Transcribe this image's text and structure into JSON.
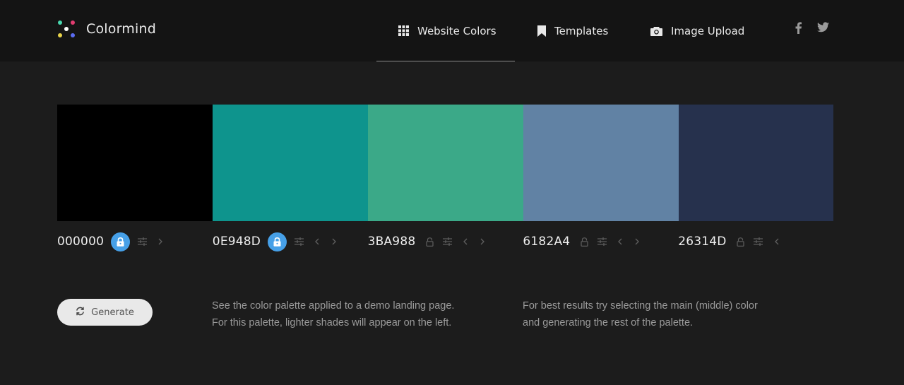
{
  "app": {
    "name": "Colormind"
  },
  "nav": [
    {
      "label": "Website Colors",
      "icon": "grid-icon",
      "active": true
    },
    {
      "label": "Templates",
      "icon": "bookmark-icon",
      "active": false
    },
    {
      "label": "Image Upload",
      "icon": "camera-icon",
      "active": false
    }
  ],
  "social": [
    {
      "icon": "facebook-icon"
    },
    {
      "icon": "twitter-icon"
    }
  ],
  "palette": [
    {
      "hex": "000000",
      "color": "#000000",
      "locked": true
    },
    {
      "hex": "0E948D",
      "color": "#0E948D",
      "locked": true
    },
    {
      "hex": "3BA988",
      "color": "#3BA988",
      "locked": false
    },
    {
      "hex": "6182A4",
      "color": "#6182A4",
      "locked": false
    },
    {
      "hex": "26314D",
      "color": "#26314D",
      "locked": false
    }
  ],
  "generate": {
    "label": "Generate"
  },
  "descriptions": [
    {
      "lines": [
        "See the color palette applied to a demo landing page.",
        "For this palette, lighter shades will appear on the left."
      ]
    },
    {
      "lines": [
        "For best results try selecting the main (middle) color",
        "and generating the rest of the palette."
      ]
    }
  ],
  "colors": {
    "header_bg": "#141414",
    "page_bg": "#1c1c1c",
    "lock_accent": "#46a0e8",
    "generate_bg": "#e9e9e9"
  }
}
